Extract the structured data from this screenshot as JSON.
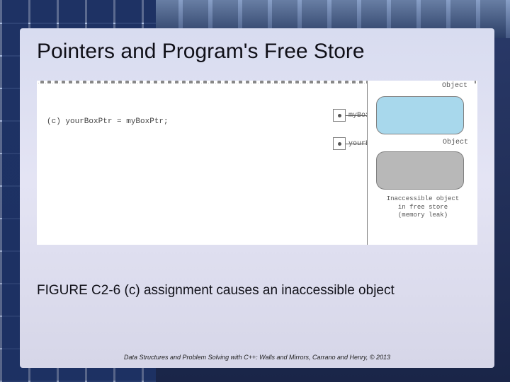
{
  "title": "Pointers and Program's Free Store",
  "figure": {
    "part_label": "(c)  yourBoxPtr = myBoxPtr;",
    "heap_header": "Object",
    "object_label": "Object",
    "pointer1_name": "myBoxPtr",
    "pointer2_name": "yourBoxPtr",
    "leak_line1": "Inaccessible object",
    "leak_line2": "in free store",
    "leak_line3": "(memory leak)"
  },
  "caption": "FIGURE C2-6 (c) assignment causes an inaccessible object",
  "footer": "Data Structures and Problem Solving with C++: Walls and Mirrors, Carrano and Henry, ©  2013"
}
